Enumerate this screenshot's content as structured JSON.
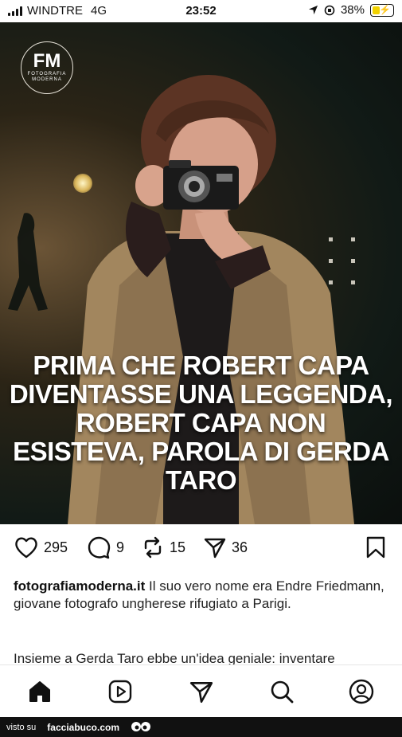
{
  "status_bar": {
    "carrier": "WINDTRE",
    "network": "4G",
    "time": "23:52",
    "battery_percent": "38%",
    "battery_level": 0.38,
    "battery_color": "#f2d200"
  },
  "post": {
    "logo": {
      "initials": "FM",
      "subtitle": "FOTOGRAFIA MODERNA"
    },
    "headline": "PRIMA CHE ROBERT CAPA DIVENTASSE UNA LEGGENDA, ROBERT CAPA NON ESISTEVA, PAROLA DI GERDA TARO",
    "likes": "295",
    "comments": "9",
    "reposts": "15",
    "shares": "36",
    "username": "fotografiamoderna.it",
    "caption": " Il suo vero nome era Endre Friedmann, giovane fotografo ungherese rifugiato a Parigi.",
    "caption_cont": "Insieme a Gerda Taro ebbe un'idea geniale: inventare"
  },
  "icons": {
    "like": "heart-icon",
    "comment": "comment-icon",
    "repost": "repost-icon",
    "share": "send-icon",
    "save": "bookmark-icon"
  },
  "nav": [
    "home-icon",
    "reels-icon",
    "send-icon",
    "search-icon",
    "profile-icon"
  ],
  "footer": {
    "prefix": "visto su",
    "site": "facciabuco.com"
  }
}
